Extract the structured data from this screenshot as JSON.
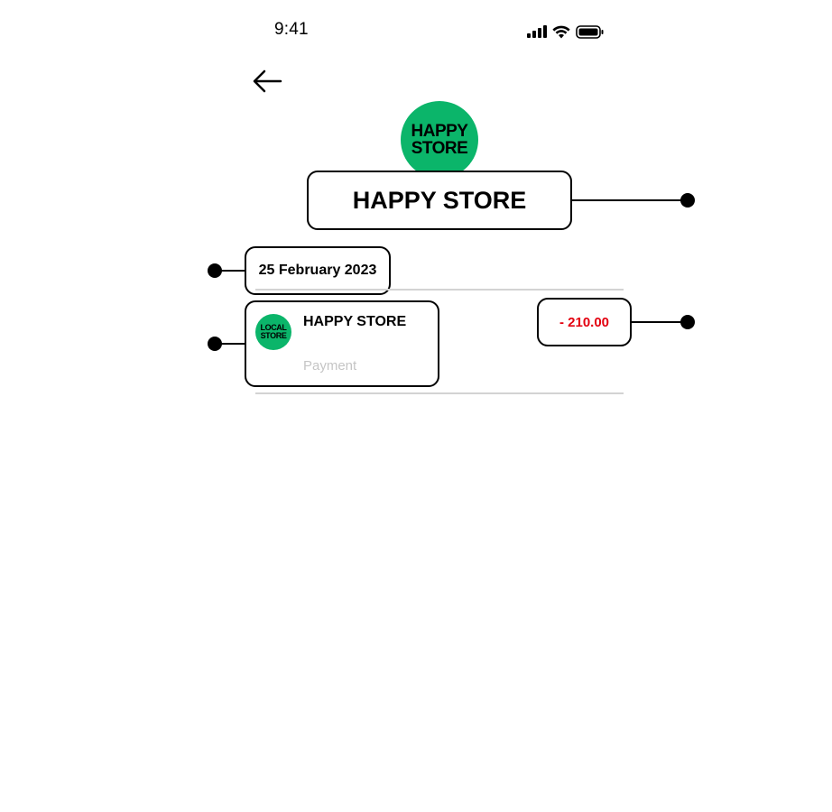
{
  "status_bar": {
    "time": "9:41"
  },
  "header": {
    "back_icon": "arrow-left-icon"
  },
  "logo": {
    "line1": "HAPPY",
    "line2": "STORE",
    "color": "#0bb56a"
  },
  "store": {
    "title": "HAPPY STORE"
  },
  "transactions": {
    "date": "25 February 2023",
    "items": [
      {
        "logo_line1": "LOCAL",
        "logo_line2": "STORE",
        "name": "HAPPY STORE",
        "type": "Payment",
        "amount": "- 210.00",
        "amount_color": "#e3000f"
      }
    ]
  }
}
